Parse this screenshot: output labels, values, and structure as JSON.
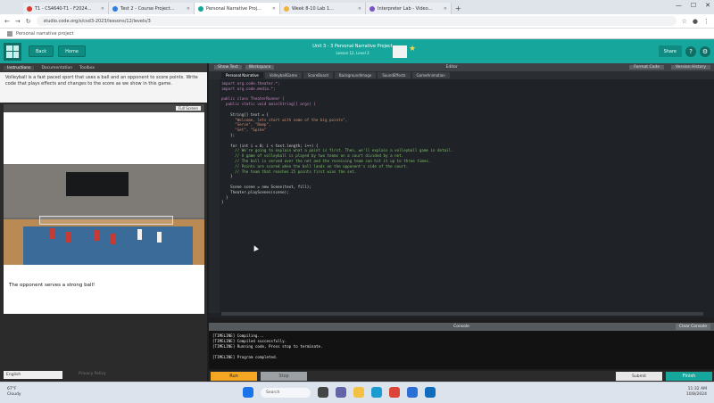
{
  "browser": {
    "tabs": [
      {
        "label": "T1 - CS4640-T1 - F2024..."
      },
      {
        "label": "Test 2 - Course Project..."
      },
      {
        "label": "Personal Narrative Proj..."
      },
      {
        "label": "Week 8-10 Lab 1..."
      },
      {
        "label": "Interpreter Lab - Video..."
      }
    ],
    "url": "studio.code.org/s/csd3-2023/lessons/12/levels/3",
    "bookmark": "Personal narrative project"
  },
  "header": {
    "back_label": "Back",
    "home_label": "Home",
    "title": "Unit 3 - 3 Personal Narrative Project",
    "subtitle": "Lesson 12, Level 3",
    "share_label": "Share"
  },
  "left": {
    "tabs": [
      "Instructions",
      "Documentation",
      "Toolbox"
    ],
    "prompt": "Volleyball is a fast paced sport that uses a ball and an opponent to score points. Write code that plays effects and changes to the score as we show in this game.",
    "video_button": "Full Screen",
    "caption": "The opponent serves a strong ball!",
    "language": "English",
    "lang_extra": "Privacy Policy"
  },
  "editor": {
    "top_tabs": [
      "Show Text",
      "Workspace"
    ],
    "center_label": "Editor",
    "right_buttons": [
      "Format Code",
      "Version History"
    ],
    "files": [
      "Personal Narrative",
      "VolleyballGame",
      "ScoreBoard",
      "BackgroundImage",
      "SoundEffects",
      "GameAnimation"
    ],
    "code_lines": [
      "import org.code.theater.*;",
      "import org.code.media.*;",
      "",
      "public class TheaterRunner {",
      "  public static void main(String[] args) {",
      "",
      "    String[] text = {",
      "      \"Welcome, lets start with some of the big points\",",
      "      \"Serve\", \"Bump\",",
      "      \"Set\", \"Spike\"",
      "    };",
      "",
      "    for (int i = 0; i < text.length; i++) {",
      "      // We're going to explain what a point is first. Then, we'll explain a volleyball game in detail.",
      "      // A game of volleyball is played by two teams on a court divided by a net.",
      "      // The ball is served over the net and the receiving team can hit it up to three times.",
      "      // Points are scored when the ball lands on the opponent's side of the court.",
      "      // The team that reaches 25 points first wins the set.",
      "    }",
      "",
      "    Scene scene = new Scene(text, fill);",
      "    Theater.playScenes(scene);",
      "  }",
      "}"
    ]
  },
  "console": {
    "title": "Console",
    "clear_label": "Clear Console",
    "lines": [
      "[TIMELINE] Compiling...",
      "[TIMELINE] Compiled successfully.",
      "[TIMELINE] Running code, Press stop to terminate.",
      "",
      "[TIMELINE] Program completed."
    ]
  },
  "actions": {
    "run_label": "Run",
    "stop_label": "Stop",
    "submit_label": "Submit",
    "next_label": "Finish"
  },
  "taskbar": {
    "weather_temp": "67°F",
    "weather_desc": "Cloudy",
    "search_placeholder": "Search",
    "time": "11:32 AM",
    "date": "10/8/2024"
  },
  "colors": {
    "accent": "#16a69b",
    "run": "#f5a623",
    "editor_bg": "#1f2226"
  }
}
